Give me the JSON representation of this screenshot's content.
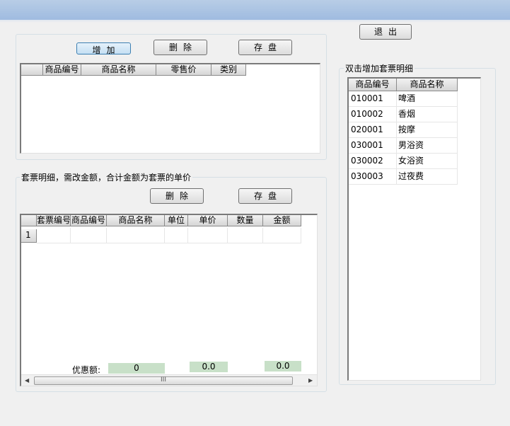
{
  "window": {
    "title": ""
  },
  "buttons": {
    "exit": "退出",
    "add": "增加",
    "delete_top": "删除",
    "save_top": "存盘",
    "delete_bottom": "删除",
    "save_bottom": "存盘"
  },
  "top_grid": {
    "columns": [
      "商品编号",
      "商品名称",
      "零售价",
      "类别"
    ]
  },
  "detail_section": {
    "label": "套票明细，需改金额，合计金额为套票的单价",
    "columns": [
      "套票编号",
      "商品编号",
      "商品名称",
      "单位",
      "单价",
      "数量",
      "金额"
    ],
    "row_number": "1",
    "discount_label": "优惠额:",
    "discount_value": "0",
    "unit_price_total": "0.0",
    "amount_total": "0.0",
    "scroll_thumb": "III"
  },
  "right_panel": {
    "label": "双击增加套票明细",
    "columns": [
      "商品编号",
      "商品名称"
    ],
    "rows": [
      [
        "010001",
        "啤酒"
      ],
      [
        "010002",
        "香烟"
      ],
      [
        "020001",
        "按摩"
      ],
      [
        "030001",
        "男浴资"
      ],
      [
        "030002",
        "女浴资"
      ],
      [
        "030003",
        "过夜费"
      ]
    ]
  }
}
